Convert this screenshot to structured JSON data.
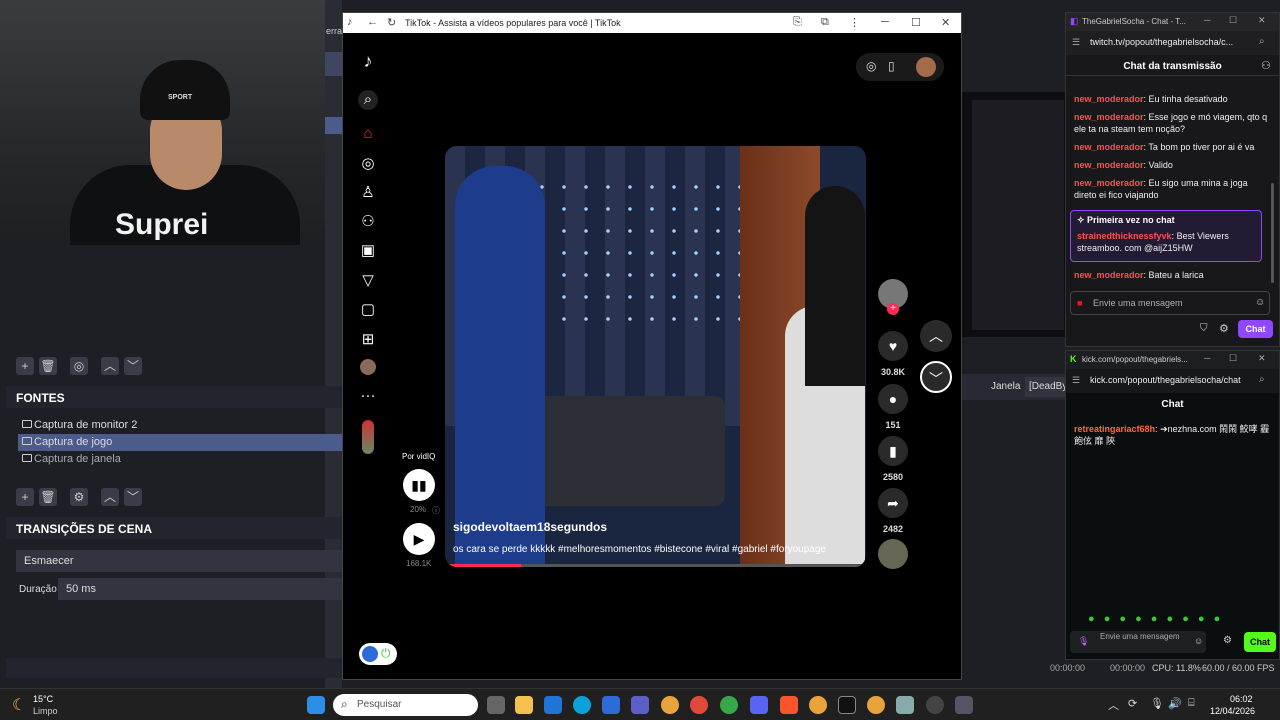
{
  "webcam": {
    "shirt_text": "Suprei",
    "hat_text": "SPORT"
  },
  "obs": {
    "left_top_label": "erra",
    "sources_header": "FONTES",
    "sources": [
      {
        "label": "Captura de monitor 2",
        "selected": false
      },
      {
        "label": "Captura de jogo",
        "selected": true
      },
      {
        "label": "Captura de janela",
        "selected": false
      }
    ],
    "transitions_header": "TRANSIÇÕES DE CENA",
    "transition_value": "Esmaecer",
    "duration_label": "Duração",
    "duration_value": "50 ms",
    "window_label": "Janela",
    "window_value": "[DeadBy",
    "status_time1": "00:00:00",
    "status_time2": "00:00:00",
    "cpu": "CPU: 11.8%",
    "fps": "60.00 / 60.00 FPS"
  },
  "tiktok": {
    "window_title": "TikTok - Assista a vídeos populares para você | TikTok",
    "by_label": "Por vidIQ",
    "vidiq_percent": "20%",
    "play_count": "168.1K",
    "video_user": "sigodevoltaem18segundos",
    "video_caption": "os cara se perde kkkkk #melhoresmomentos #bistecone #viral #gabriel #foryoupage",
    "likes": "30.8K",
    "comments": "151",
    "saves": "2580",
    "shares": "2482"
  },
  "twitch": {
    "window_title": "TheGabrielSocha - Chat - T...",
    "url": "twitch.tv/popout/thegabrielsocha/c...",
    "header": "Chat da transmissão",
    "messages": [
      {
        "user": "new_moderador",
        "text": "Eu tinha desativado"
      },
      {
        "user": "new_moderador",
        "text": "Esse jogo e mó viagem, qto q ele ta na steam tem noção?"
      },
      {
        "user": "new_moderador",
        "text": "Ta bom po tiver por ai é va"
      },
      {
        "user": "new_moderador",
        "text": "Valido"
      },
      {
        "user": "new_moderador",
        "text": "Eu sigo uma mina a joga direto ei fico viajando"
      }
    ],
    "first_time_label": "Primeira vez no chat",
    "first_user": "strainedthicknessfyvk",
    "first_text": "Best Viewers streamboo. com @aijZ15HW",
    "last_user": "new_moderador",
    "last_text": "Bateu a larica",
    "input_placeholder": "Envie uma mensagem",
    "chat_button": "Chat"
  },
  "kick": {
    "window_title": "kick.com/popout/thegabriels...",
    "url": "kick.com/popout/thegabrielsocha/chat",
    "header": "Chat",
    "msg_user": "retreatingariacf68h",
    "msg_text": "➔nezhna.com 鬧鬧 鮫哮 霾 飽伭 靡 陝",
    "input_placeholder": "Envie uma mensagem",
    "chat_button": "Chat"
  },
  "taskbar": {
    "weather_temp": "15°C",
    "weather_desc": "Limpo",
    "search_placeholder": "Pesquisar",
    "time": "06:02",
    "date": "12/04/2026"
  },
  "colors": {
    "tiktok_red": "#fe2c55",
    "twitch_purple": "#9147ff",
    "kick_green": "#53fc18"
  }
}
